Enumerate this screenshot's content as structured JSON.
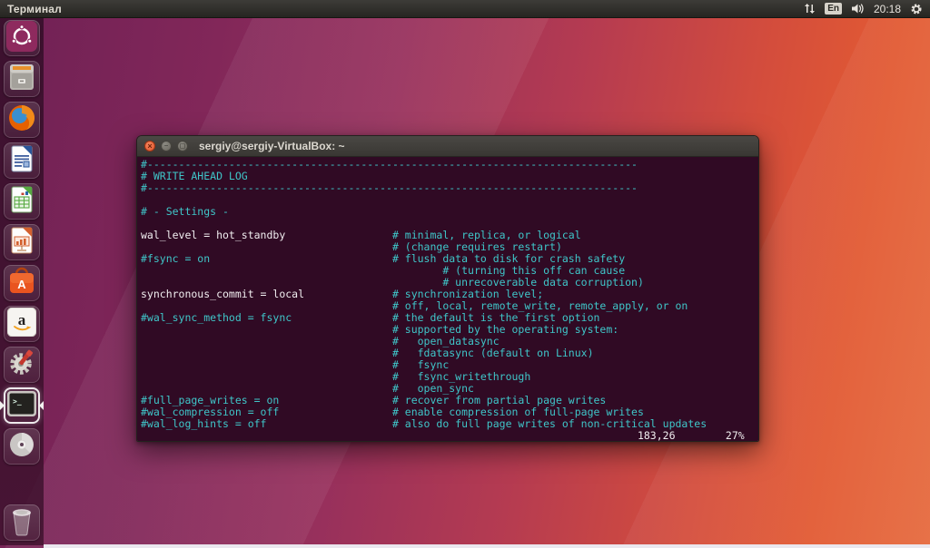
{
  "panel": {
    "app_title": "Терминал",
    "keyboard_layout": "En",
    "time": "20:18",
    "icons": [
      "network-arrows-icon",
      "keyboard-layout-badge",
      "sound-icon",
      "clock",
      "session-gear-icon"
    ]
  },
  "launcher": {
    "items": [
      {
        "icon": "ubuntu-dash",
        "label": "Ubuntu Dash",
        "active": false
      },
      {
        "icon": "file-manager",
        "label": "Files",
        "active": false
      },
      {
        "icon": "firefox",
        "label": "Firefox",
        "active": false
      },
      {
        "icon": "libreoffice-writer",
        "label": "LibreOffice Writer",
        "active": false
      },
      {
        "icon": "libreoffice-calc",
        "label": "LibreOffice Calc",
        "active": false
      },
      {
        "icon": "libreoffice-impress",
        "label": "LibreOffice Impress",
        "active": false
      },
      {
        "icon": "software-center",
        "label": "Ubuntu Software",
        "active": false
      },
      {
        "icon": "amazon",
        "label": "Amazon",
        "active": false
      },
      {
        "icon": "system-settings",
        "label": "System Settings",
        "active": false
      },
      {
        "icon": "terminal",
        "label": "Terminal",
        "active": true
      },
      {
        "icon": "disc",
        "label": "Disc",
        "active": false
      },
      {
        "icon": "trash",
        "label": "Trash",
        "active": false,
        "bottom": true
      }
    ]
  },
  "window": {
    "title": "sergiy@sergiy-VirtualBox: ~",
    "buttons": {
      "close": "×",
      "minimize": "−",
      "maximize": "◻"
    }
  },
  "terminal": {
    "status": {
      "cursor_position": "183,26",
      "scroll_percent": "27%"
    },
    "colors": {
      "background": "#300a24",
      "comment": "#3fc6c9",
      "normal": "#f1eef0"
    },
    "lines": [
      [
        {
          "c": "comment",
          "t": "#------------------------------------------------------------------------------"
        }
      ],
      [
        {
          "c": "comment",
          "t": "# WRITE AHEAD LOG"
        }
      ],
      [
        {
          "c": "comment",
          "t": "#------------------------------------------------------------------------------"
        }
      ],
      [],
      [
        {
          "c": "comment",
          "t": "# - Settings -"
        }
      ],
      [],
      [
        {
          "c": "normal",
          "t": "wal_level = hot_standby"
        },
        {
          "c": "comment",
          "t": "                 # minimal, replica, or logical"
        }
      ],
      [
        {
          "c": "comment",
          "t": "                                        # (change requires restart)"
        }
      ],
      [
        {
          "c": "comment",
          "t": "#fsync = on                             # flush data to disk for crash safety"
        }
      ],
      [
        {
          "c": "comment",
          "t": "                                                # (turning this off can cause"
        }
      ],
      [
        {
          "c": "comment",
          "t": "                                                # unrecoverable data corruption)"
        }
      ],
      [
        {
          "c": "normal",
          "t": "synchronous_commit = local"
        },
        {
          "c": "comment",
          "t": "              # synchronization level;"
        }
      ],
      [
        {
          "c": "comment",
          "t": "                                        # off, local, remote_write, remote_apply, or on"
        }
      ],
      [
        {
          "c": "comment",
          "t": "#wal_sync_method = fsync                # the default is the first option"
        }
      ],
      [
        {
          "c": "comment",
          "t": "                                        # supported by the operating system:"
        }
      ],
      [
        {
          "c": "comment",
          "t": "                                        #   open_datasync"
        }
      ],
      [
        {
          "c": "comment",
          "t": "                                        #   fdatasync (default on Linux)"
        }
      ],
      [
        {
          "c": "comment",
          "t": "                                        #   fsync"
        }
      ],
      [
        {
          "c": "comment",
          "t": "                                        #   fsync_writethrough"
        }
      ],
      [
        {
          "c": "comment",
          "t": "                                        #   open_sync"
        }
      ],
      [
        {
          "c": "comment",
          "t": "#full_page_writes = on                  # recover from partial page writes"
        }
      ],
      [
        {
          "c": "comment",
          "t": "#wal_compression = off                  # enable compression of full-page writes"
        }
      ],
      [
        {
          "c": "comment",
          "t": "#wal_log_hints = off                    # also do full page writes of non-critical updates"
        }
      ],
      [
        {
          "c": "normal",
          "t": "                                                                               183,26        27%"
        }
      ]
    ]
  }
}
